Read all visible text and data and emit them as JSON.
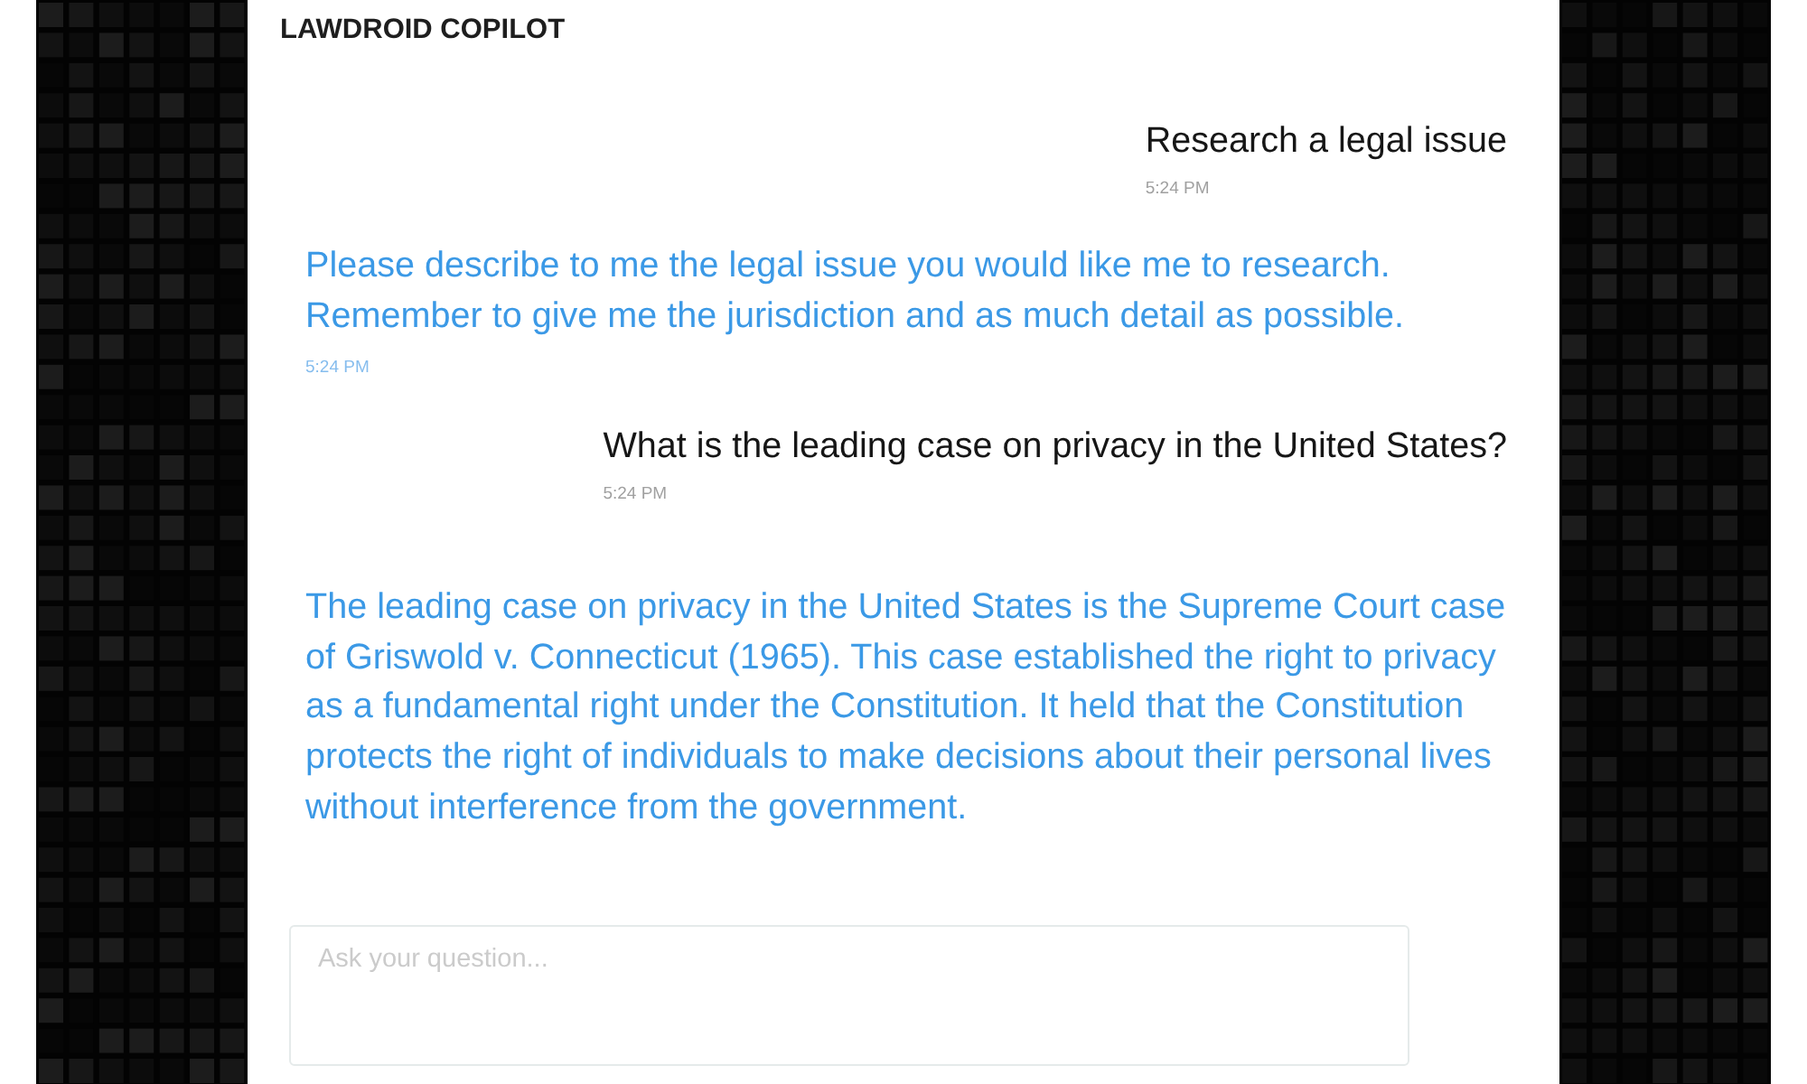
{
  "app": {
    "title": "LAWDROID COPILOT"
  },
  "messages": [
    {
      "kind": "user",
      "text": "Research a legal issue",
      "time": "5:24 PM"
    },
    {
      "kind": "bot",
      "text": "Please describe to me the legal issue you would like me to research. Remember to give me the jurisdiction and as much detail as possible.",
      "time": "5:24 PM"
    },
    {
      "kind": "user",
      "text": "What is the leading case on privacy in the United States?",
      "time": "5:24 PM"
    },
    {
      "kind": "bot",
      "text": "The leading case on privacy in the United States is the Supreme Court case of Griswold v. Connecticut (1965). This case established the right to privacy as a fundamental right under the Constitution. It held that the Constitution protects the right of individuals to make decisions about their personal lives without interference from the government."
    }
  ],
  "composer": {
    "placeholder": "Ask your question..."
  }
}
